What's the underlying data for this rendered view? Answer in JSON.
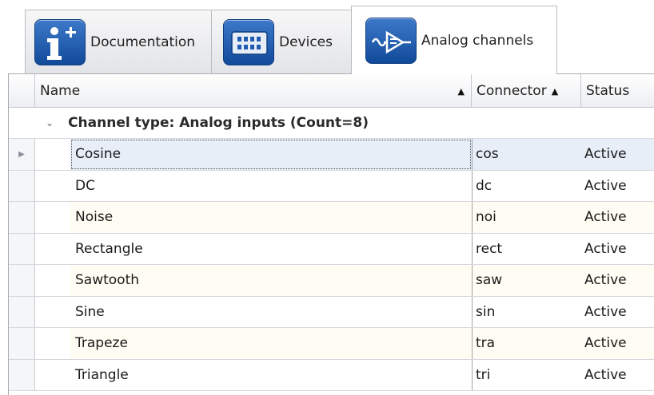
{
  "tabs": [
    {
      "label": "Documentation",
      "icon": "documentation-info-icon"
    },
    {
      "label": "Devices",
      "icon": "devices-icon"
    },
    {
      "label": "Analog channels",
      "icon": "analog-channels-icon"
    }
  ],
  "grid": {
    "columns": {
      "name": "Name",
      "connector": "Connector",
      "status": "Status"
    },
    "sort_glyph": "▲",
    "group_chevron": "⌄",
    "row_indicator": "▶",
    "group_label": "Channel type: Analog inputs (Count=8)",
    "rows": [
      {
        "name": "Cosine",
        "connector": "cos",
        "status": "Active"
      },
      {
        "name": "DC",
        "connector": "dc",
        "status": "Active"
      },
      {
        "name": "Noise",
        "connector": "noi",
        "status": "Active"
      },
      {
        "name": "Rectangle",
        "connector": "rect",
        "status": "Active"
      },
      {
        "name": "Sawtooth",
        "connector": "saw",
        "status": "Active"
      },
      {
        "name": "Sine",
        "connector": "sin",
        "status": "Active"
      },
      {
        "name": "Trapeze",
        "connector": "tra",
        "status": "Active"
      },
      {
        "name": "Triangle",
        "connector": "tri",
        "status": "Active"
      }
    ]
  },
  "colors": {
    "icon_blue": "#1f5bb0",
    "selected_row": "#e7eef8",
    "alt_row": "#fffdf3"
  }
}
